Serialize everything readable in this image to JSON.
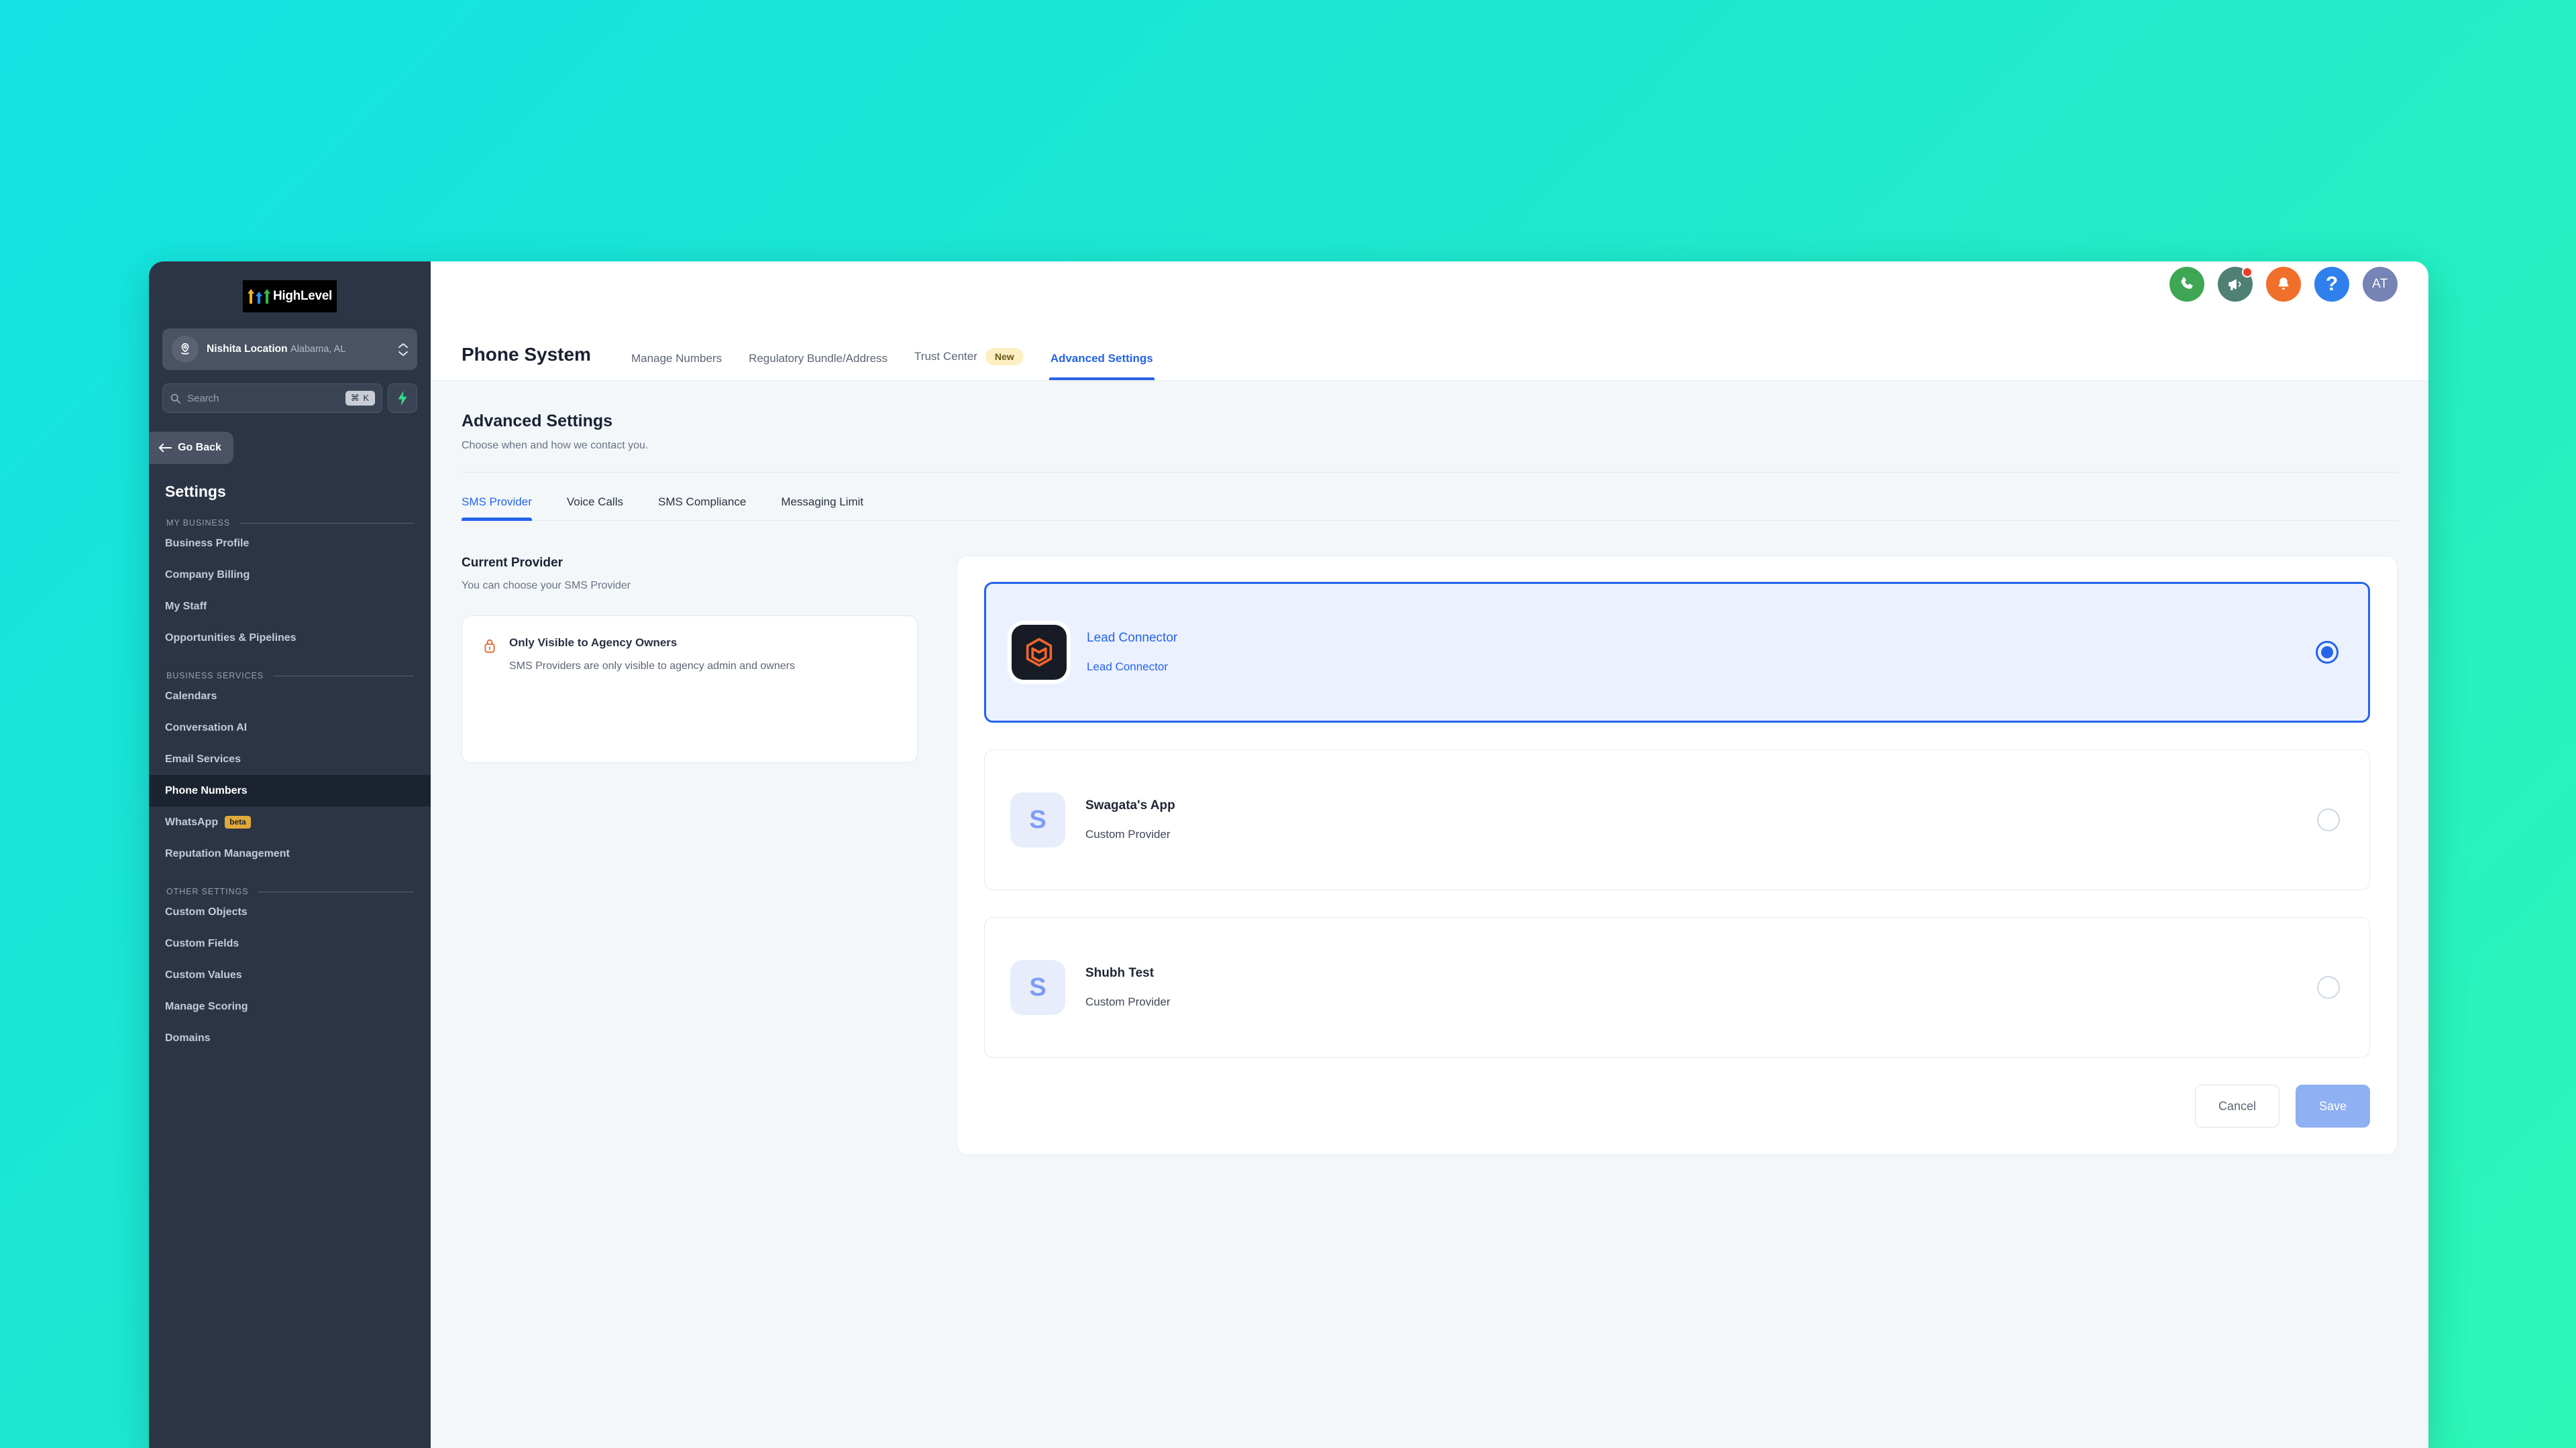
{
  "brand": {
    "logo_text": "HighLevel",
    "accent_blue": "#2563EB",
    "sidebar_bg": "#2C3545",
    "page_bg_gradient_from": "#12E2E2",
    "page_bg_gradient_to": "#2DF7B6"
  },
  "sidebar": {
    "location": {
      "name": "Nishita Location",
      "sub": "Alabama, AL"
    },
    "search": {
      "placeholder": "Search",
      "shortcut": "⌘ K"
    },
    "go_back_label": "Go Back",
    "settings_title": "Settings",
    "groups": [
      {
        "label": "MY BUSINESS",
        "items": [
          {
            "label": "Business Profile",
            "active": false
          },
          {
            "label": "Company Billing",
            "active": false
          },
          {
            "label": "My Staff",
            "active": false
          },
          {
            "label": "Opportunities & Pipelines",
            "active": false
          }
        ]
      },
      {
        "label": "BUSINESS SERVICES",
        "items": [
          {
            "label": "Calendars",
            "active": false
          },
          {
            "label": "Conversation AI",
            "active": false
          },
          {
            "label": "Email Services",
            "active": false
          },
          {
            "label": "Phone Numbers",
            "active": true
          },
          {
            "label": "WhatsApp",
            "active": false,
            "badge": "beta"
          },
          {
            "label": "Reputation Management",
            "active": false
          }
        ]
      },
      {
        "label": "OTHER SETTINGS",
        "items": [
          {
            "label": "Custom Objects",
            "active": false
          },
          {
            "label": "Custom Fields",
            "active": false
          },
          {
            "label": "Custom Values",
            "active": false
          },
          {
            "label": "Manage Scoring",
            "active": false
          },
          {
            "label": "Domains",
            "active": false
          }
        ]
      }
    ]
  },
  "topbar": {
    "icons": [
      {
        "name": "phone-icon",
        "color": "#3FA654"
      },
      {
        "name": "megaphone-icon",
        "color": "#4F8073",
        "badge": true
      },
      {
        "name": "bell-icon",
        "color": "#F0702B"
      },
      {
        "name": "help-icon",
        "color": "#2F80ED"
      }
    ],
    "avatar_initials": "AT",
    "avatar_color": "#7583B5"
  },
  "header": {
    "title": "Phone System",
    "tabs": [
      {
        "label": "Manage Numbers",
        "active": false
      },
      {
        "label": "Regulatory Bundle/Address",
        "active": false
      },
      {
        "label": "Trust Center",
        "active": false,
        "badge": "New"
      },
      {
        "label": "Advanced Settings",
        "active": true
      }
    ]
  },
  "main": {
    "page_title": "Advanced Settings",
    "page_subtitle": "Choose when and how we contact you.",
    "subtabs": [
      {
        "label": "SMS Provider",
        "active": true
      },
      {
        "label": "Voice Calls",
        "active": false
      },
      {
        "label": "SMS Compliance",
        "active": false
      },
      {
        "label": "Messaging Limit",
        "active": false
      }
    ],
    "current_provider": {
      "title": "Current Provider",
      "subtitle": "You can choose your SMS Provider",
      "notice": {
        "icon": "lock-icon",
        "title": "Only Visible to Agency Owners",
        "text": "SMS Providers are only visible to agency admin and owners"
      }
    },
    "providers": [
      {
        "name": "Lead Connector",
        "type": "Lead Connector",
        "logo_kind": "leadconnector",
        "logo_letter": "",
        "selected": true
      },
      {
        "name": "Swagata's App",
        "type": "Custom Provider",
        "logo_kind": "letter",
        "logo_letter": "S",
        "selected": false
      },
      {
        "name": "Shubh Test",
        "type": "Custom Provider",
        "logo_kind": "letter",
        "logo_letter": "S",
        "selected": false
      }
    ],
    "actions": {
      "cancel_label": "Cancel",
      "save_label": "Save"
    }
  }
}
